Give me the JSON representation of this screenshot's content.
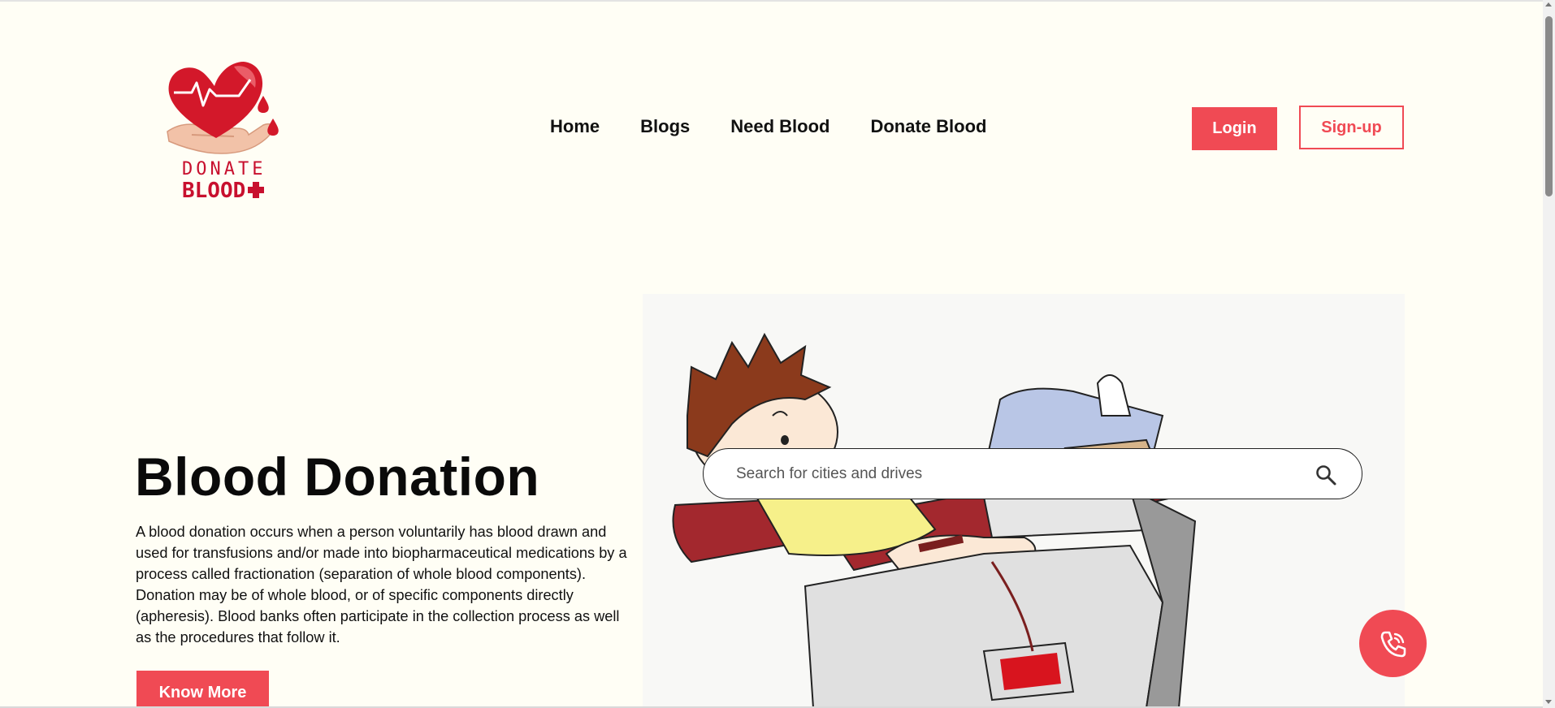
{
  "logo": {
    "line1": "DONATE",
    "line2": "BLOOD",
    "icon": "heart-hand-blood-drops-logo"
  },
  "nav": {
    "items": [
      {
        "label": "Home"
      },
      {
        "label": "Blogs"
      },
      {
        "label": "Need Blood"
      },
      {
        "label": "Donate Blood"
      }
    ],
    "login_label": "Login",
    "signup_label": "Sign-up"
  },
  "hero": {
    "title": "Blood Donation",
    "description": "A blood donation occurs when a person voluntarily has blood drawn and used for transfusions and/or made into biopharmaceutical medications by a process called fractionation (separation of whole blood components). Donation may be of whole blood, or of specific components directly (apheresis). Blood banks often participate in the collection process as well as the procedures that follow it.",
    "cta_label": "Know More"
  },
  "search": {
    "placeholder": "Search for cities and drives",
    "icon": "search-icon"
  },
  "call_button": {
    "icon": "phone-call-icon"
  },
  "colors": {
    "accent": "#f04a54",
    "background": "#fffef5",
    "logo_red": "#c8102e"
  }
}
